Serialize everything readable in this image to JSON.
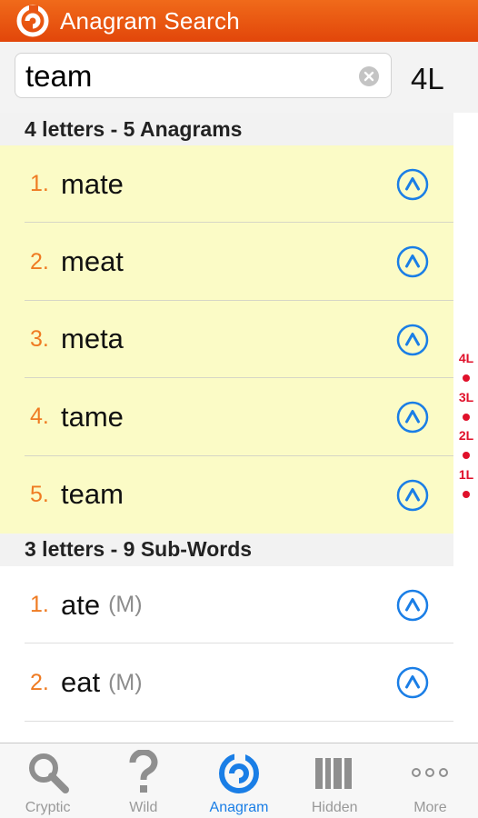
{
  "header": {
    "title": "Anagram Search"
  },
  "search": {
    "value": "team",
    "length_label": "4L"
  },
  "sections": [
    {
      "title": "4 letters - 5 Anagrams",
      "items": [
        {
          "num": "1.",
          "word": "mate",
          "tag": ""
        },
        {
          "num": "2.",
          "word": "meat",
          "tag": ""
        },
        {
          "num": "3.",
          "word": "meta",
          "tag": ""
        },
        {
          "num": "4.",
          "word": "tame",
          "tag": ""
        },
        {
          "num": "5.",
          "word": "team",
          "tag": ""
        }
      ]
    },
    {
      "title": "3 letters - 9 Sub-Words",
      "items": [
        {
          "num": "1.",
          "word": "ate",
          "tag": "(M)"
        },
        {
          "num": "2.",
          "word": "eat",
          "tag": "(M)"
        }
      ]
    }
  ],
  "index": [
    "4L",
    "3L",
    "2L",
    "1L"
  ],
  "tabs": [
    {
      "label": "Cryptic",
      "icon": "magnifier-icon"
    },
    {
      "label": "Wild",
      "icon": "question-mark-icon"
    },
    {
      "label": "Anagram",
      "icon": "anagram-swirl-icon",
      "active": true
    },
    {
      "label": "Hidden",
      "icon": "hidden-bars-icon"
    },
    {
      "label": "More",
      "icon": "more-dots-icon"
    }
  ],
  "colors": {
    "header": "#e85614",
    "accent_blue": "#1a7ee6",
    "number_orange": "#ef7b22",
    "highlight_yellow": "#fbfbc6",
    "index_red": "#e0102a"
  }
}
